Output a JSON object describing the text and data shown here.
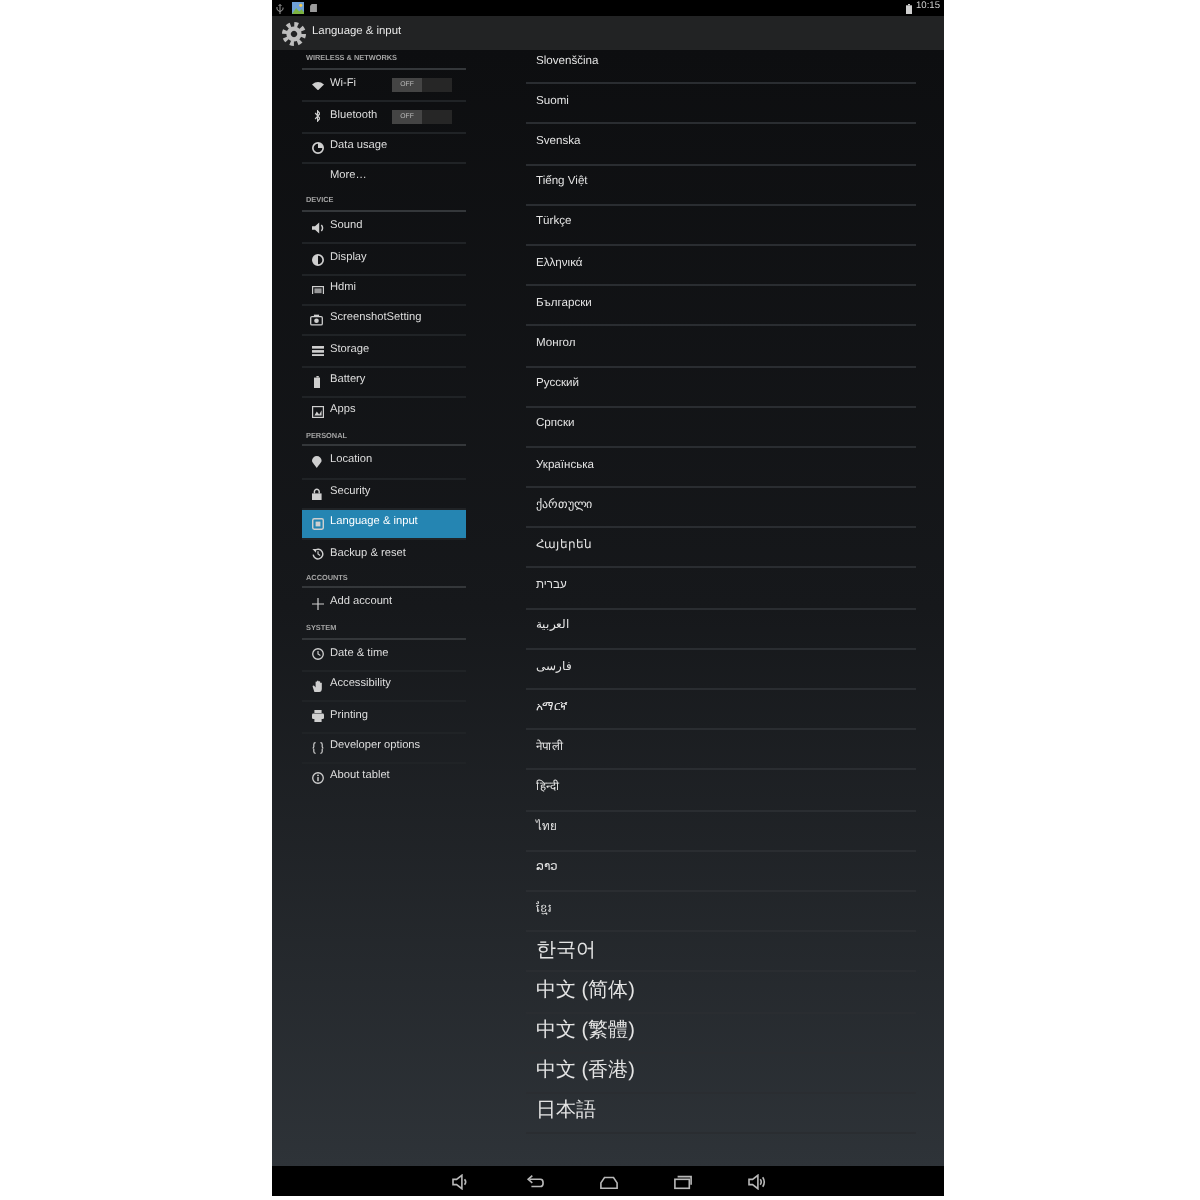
{
  "status_bar": {
    "time": "10:15"
  },
  "action_bar": {
    "title": "Language & input"
  },
  "sidebar": {
    "sections": [
      {
        "header": "WIRELESS & NETWORKS",
        "items": [
          {
            "label": "Wi-Fi",
            "kind": "toggle",
            "switch_label": "OFF",
            "on": false,
            "selected": false
          },
          {
            "label": "Bluetooth",
            "kind": "toggle",
            "switch_label": "OFF",
            "on": false,
            "selected": false
          },
          {
            "label": "Data usage",
            "kind": "icon",
            "selected": false
          },
          {
            "label": "More…",
            "kind": "plain",
            "selected": false
          }
        ]
      },
      {
        "header": "DEVICE",
        "items": [
          {
            "label": "Sound",
            "kind": "icon",
            "selected": false
          },
          {
            "label": "Display",
            "kind": "icon",
            "selected": false
          },
          {
            "label": "Hdmi",
            "kind": "icon",
            "selected": false
          },
          {
            "label": "ScreenshotSetting",
            "kind": "icon",
            "selected": false
          },
          {
            "label": "Storage",
            "kind": "icon",
            "selected": false
          },
          {
            "label": "Battery",
            "kind": "icon",
            "selected": false
          },
          {
            "label": "Apps",
            "kind": "icon",
            "selected": false
          }
        ]
      },
      {
        "header": "PERSONAL",
        "items": [
          {
            "label": "Location",
            "kind": "icon",
            "selected": false
          },
          {
            "label": "Security",
            "kind": "icon",
            "selected": false
          },
          {
            "label": "Language & input",
            "kind": "icon",
            "selected": true
          },
          {
            "label": "Backup & reset",
            "kind": "icon",
            "selected": false
          }
        ]
      },
      {
        "header": "ACCOUNTS",
        "items": [
          {
            "label": "Add account",
            "kind": "icon",
            "selected": false
          }
        ]
      },
      {
        "header": "SYSTEM",
        "items": [
          {
            "label": "Date & time",
            "kind": "icon",
            "selected": false
          },
          {
            "label": "Accessibility",
            "kind": "icon",
            "selected": false
          },
          {
            "label": "Printing",
            "kind": "icon",
            "selected": false
          },
          {
            "label": "Developer options",
            "kind": "icon",
            "selected": false
          },
          {
            "label": "About tablet",
            "kind": "icon",
            "selected": false
          }
        ]
      }
    ]
  },
  "languages": [
    "Slovenščina",
    "Suomi",
    "Svenska",
    "Tiếng Việt",
    "Türkçe",
    "Ελληνικά",
    "Български",
    "Монгол",
    "Русский",
    "Српски",
    "Українська",
    "ქართული",
    "Հայերեն",
    "עברית",
    "العربية",
    "فارسی",
    "አማርኛ",
    "नेपाली",
    "हिन्दी",
    "ไทย",
    "ລາວ",
    "ខ្មែរ",
    "한국어",
    "中文 (简体)",
    "中文 (繁體)",
    "中文 (香港)",
    "日本語"
  ]
}
